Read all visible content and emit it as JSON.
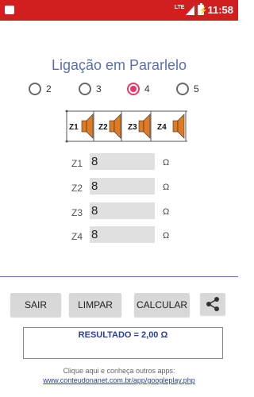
{
  "status_bar": {
    "time": "11:58",
    "network": "LTE"
  },
  "title": "Ligação em Pararlelo",
  "radios": [
    {
      "label": "2",
      "selected": false
    },
    {
      "label": "3",
      "selected": false
    },
    {
      "label": "4",
      "selected": true
    },
    {
      "label": "5",
      "selected": false
    }
  ],
  "diagram": {
    "labels": [
      "Z1",
      "Z2",
      "Z3",
      "Z4"
    ],
    "accent": "#e07b22"
  },
  "impedances": [
    {
      "label": "Z1",
      "value": "8",
      "unit": "Ω"
    },
    {
      "label": "Z2",
      "value": "8",
      "unit": "Ω"
    },
    {
      "label": "Z3",
      "value": "8",
      "unit": "Ω"
    },
    {
      "label": "Z4",
      "value": "8",
      "unit": "Ω"
    }
  ],
  "buttons": {
    "exit": "SAIR",
    "clear": "LIMPAR",
    "calculate": "CALCULAR",
    "share_icon": "share-icon"
  },
  "result": "RESULTADO = 2,00 Ω",
  "footer": {
    "text": "Clique aqui e conheça outros apps:",
    "link": "www.conteudonanet.com.br/app/googleplay.php"
  },
  "colors": {
    "status_bar": "#d11e1e",
    "title": "#5a6fb3",
    "radio_selected": "#e5396b",
    "result_text": "#2a3fa0"
  }
}
